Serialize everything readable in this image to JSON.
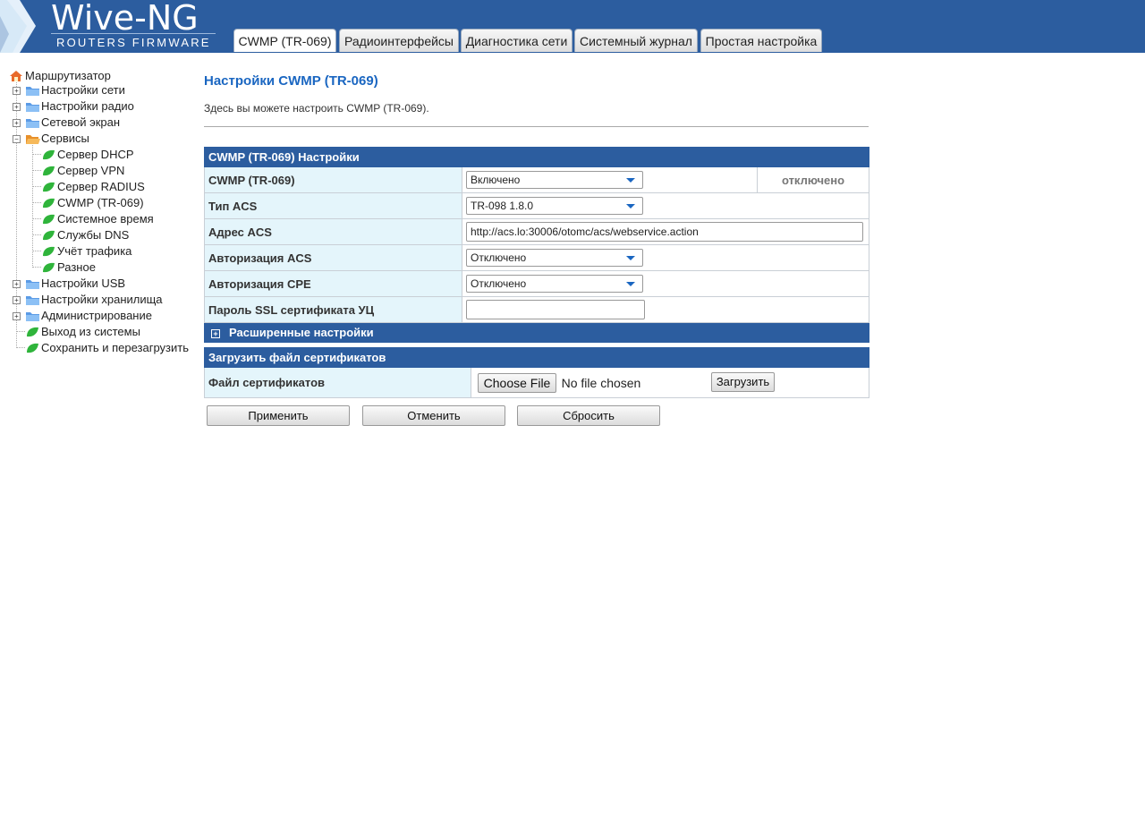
{
  "logo": {
    "title": "Wive-NG",
    "subtitle": "ROUTERS FIRMWARE"
  },
  "tabs": [
    "CWMP (TR-069)",
    "Радиоинтерфейсы",
    "Диагностика сети",
    "Системный журнал",
    "Простая настройка"
  ],
  "tree": {
    "root": "Маршрутизатор",
    "items": [
      "Настройки сети",
      "Настройки радио",
      "Сетевой экран",
      "Сервисы",
      "Сервер DHCP",
      "Сервер VPN",
      "Сервер RADIUS",
      "CWMP (TR-069)",
      "Системное время",
      "Службы DNS",
      "Учёт трафика",
      "Разное",
      "Настройки USB",
      "Настройки хранилища",
      "Администрирование",
      "Выход из системы",
      "Сохранить и перезагрузить"
    ]
  },
  "page": {
    "title": "Настройки CWMP (TR-069)",
    "description": "Здесь вы можете настроить CWMP (TR-069)."
  },
  "settings": {
    "header": "CWMP (TR-069) Настройки",
    "cwmp_label": "CWMP (TR-069)",
    "cwmp_value": "Включено",
    "cwmp_status": "отключено",
    "acs_type_label": "Тип ACS",
    "acs_type_value": "TR-098 1.8.0",
    "acs_url_label": "Адрес ACS",
    "acs_url_value": "http://acs.lo:30006/otomc/acs/webservice.action",
    "acs_auth_label": "Авторизация ACS",
    "acs_auth_value": "Отключено",
    "cpe_auth_label": "Авторизация CPE",
    "cpe_auth_value": "Отключено",
    "ssl_label": "Пароль SSL сертификата УЦ",
    "ssl_value": "",
    "advanced": "Расширенные настройки"
  },
  "upload": {
    "header": "Загрузить файл сертификатов",
    "label": "Файл сертификатов",
    "choose": "Choose File",
    "no_file": "No file chosen",
    "button": "Загрузить"
  },
  "buttons": {
    "apply": "Применить",
    "cancel": "Отменить",
    "reset": "Сбросить"
  },
  "colors": {
    "header": "#2c5d9f",
    "title": "#1a66c1",
    "label_bg": "#e4f5fb"
  }
}
